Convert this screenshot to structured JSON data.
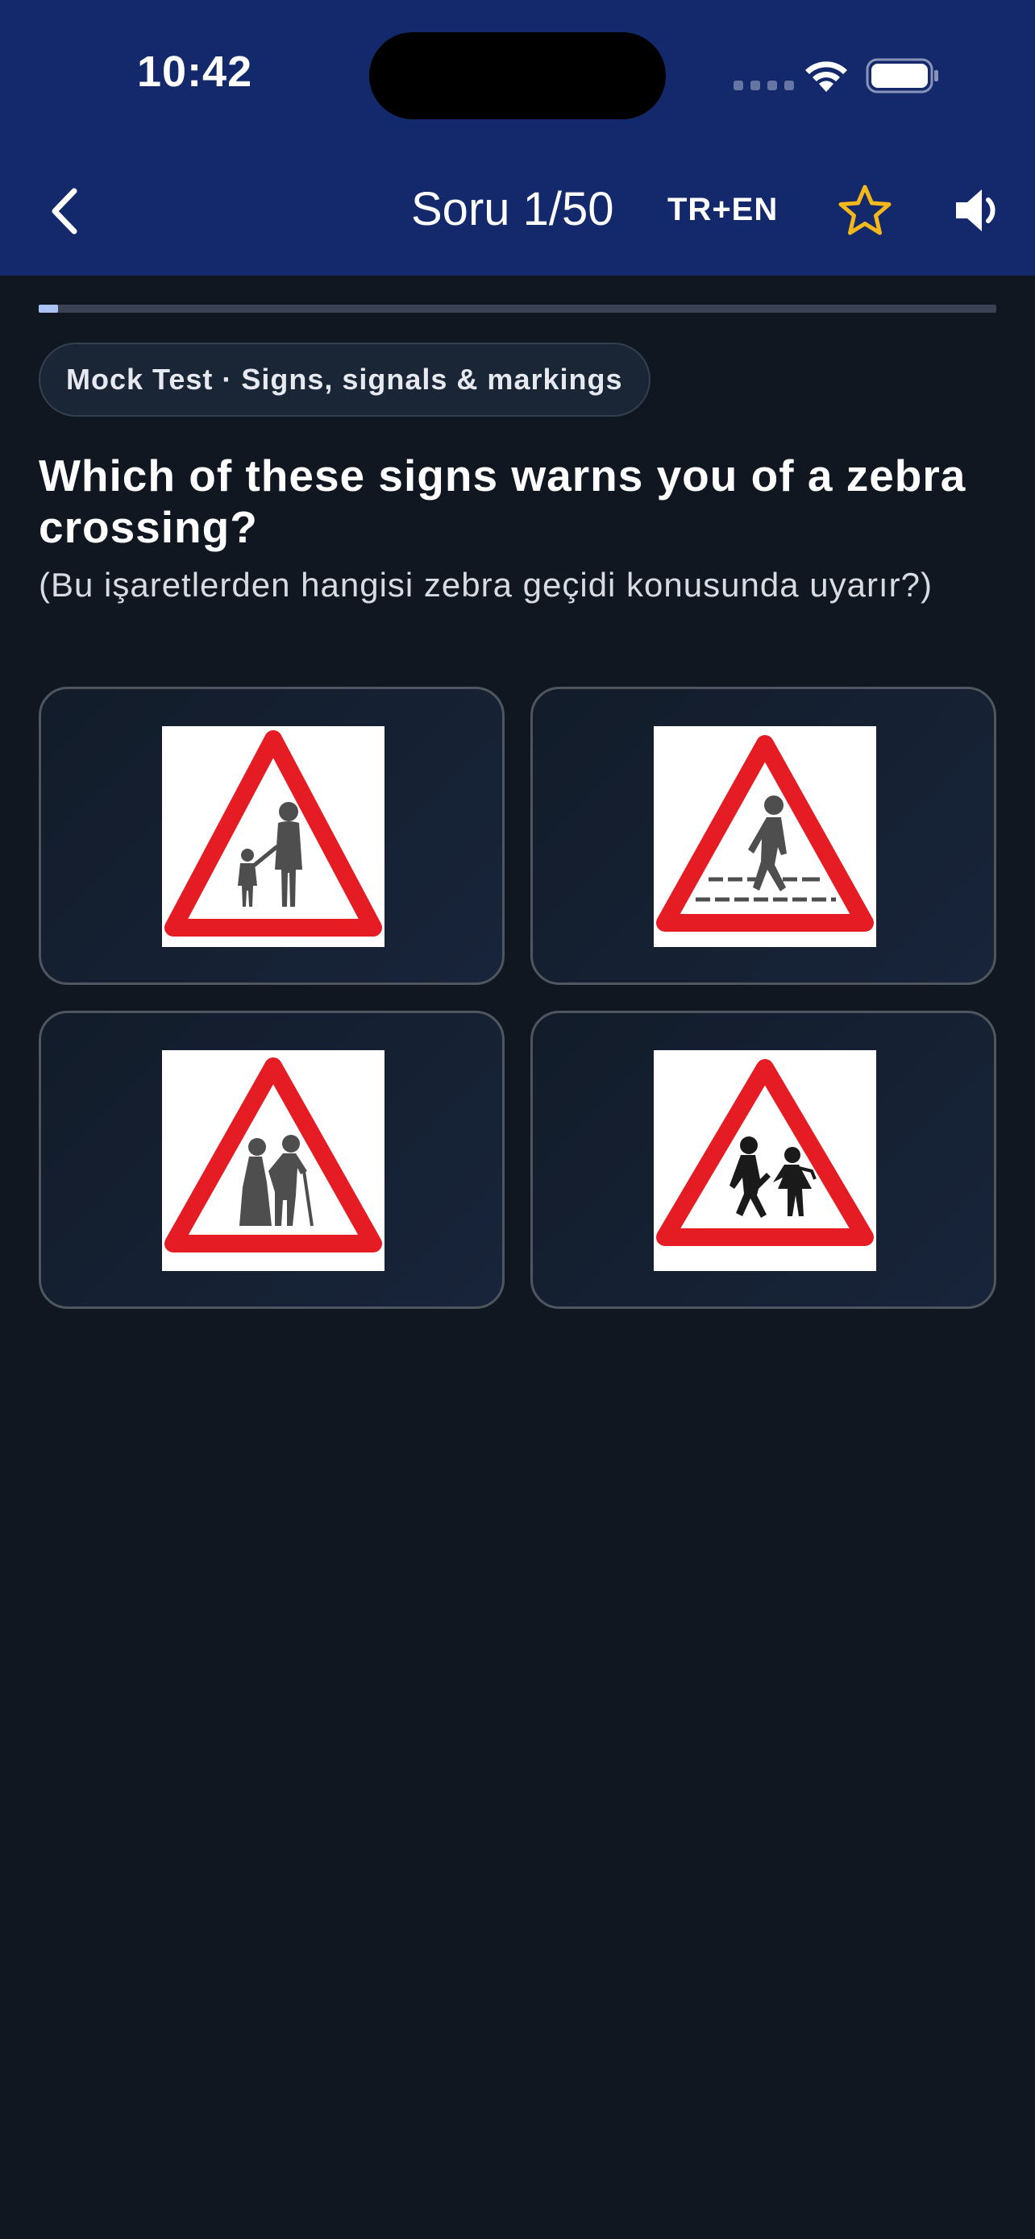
{
  "status_bar": {
    "time": "10:42"
  },
  "nav": {
    "title": "Soru 1/50",
    "language_toggle": "TR+EN",
    "icons": [
      "chevron-left-icon",
      "star-outline-icon",
      "speaker-icon"
    ],
    "star_color": "#f2b81c"
  },
  "progress": {
    "current": 1,
    "total": 50,
    "fraction": 0.02
  },
  "category_chip": "Mock Test · Signs, signals & markings",
  "question": {
    "english": "Which of these signs warns you of a zebra crossing?",
    "turkish": "(Bu işaretlerden hangisi zebra geçidi konusunda uyarır?)"
  },
  "options": [
    {
      "id": "a",
      "icon": "adult-and-child-warning-sign-icon"
    },
    {
      "id": "b",
      "icon": "pedestrian-crossing-warning-sign-icon"
    },
    {
      "id": "c",
      "icon": "elderly-people-warning-sign-icon"
    },
    {
      "id": "d",
      "icon": "children-crossing-warning-sign-icon"
    }
  ],
  "colors": {
    "header_bg": "#13296b",
    "page_bg": "#111720",
    "sign_red": "#e51c23",
    "progress_fill": "#a9c4f5"
  }
}
